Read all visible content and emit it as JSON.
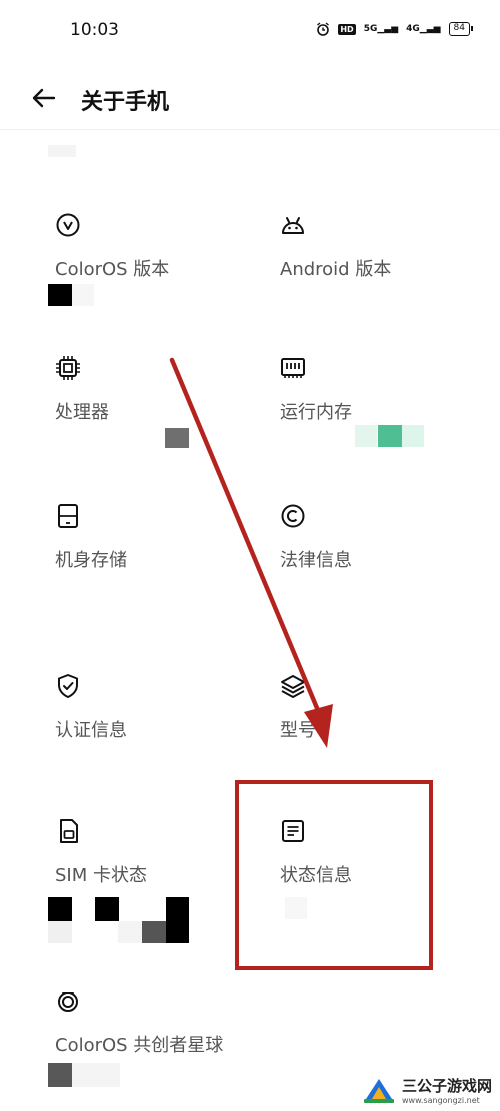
{
  "status_bar": {
    "time": "10:03",
    "hd": "HD",
    "signal1": "5G",
    "signal2": "4G",
    "battery": "84"
  },
  "header": {
    "title": "关于手机"
  },
  "tiles": [
    {
      "name": "coloros-version",
      "label": "ColorOS 版本",
      "value": "",
      "icon": "v-circle-icon"
    },
    {
      "name": "android-version",
      "label": "Android 版本",
      "value": "",
      "icon": "android-icon"
    },
    {
      "name": "processor",
      "label": "处理器",
      "value": "",
      "icon": "chip-icon"
    },
    {
      "name": "ram",
      "label": "运行内存",
      "value": "",
      "icon": "memory-icon"
    },
    {
      "name": "storage",
      "label": "机身存储",
      "value": "",
      "icon": "storage-icon"
    },
    {
      "name": "legal",
      "label": "法律信息",
      "value": "",
      "icon": "copyright-icon"
    },
    {
      "name": "certification",
      "label": "认证信息",
      "value": "",
      "icon": "shield-check-icon"
    },
    {
      "name": "model",
      "label": "型号",
      "value": "",
      "icon": "layers-icon"
    },
    {
      "name": "sim-status",
      "label": "SIM 卡状态",
      "value": "",
      "icon": "sim-card-icon"
    },
    {
      "name": "status-info",
      "label": "状态信息",
      "value": "",
      "icon": "document-icon"
    },
    {
      "name": "coloros-cocreate",
      "label": "ColorOS 共创者星球",
      "value": "",
      "icon": "planet-icon"
    }
  ],
  "colors": {
    "annotation": "#b5231f",
    "accent_green": "#4fbf93"
  },
  "watermark": {
    "title": "三公子游戏网",
    "url": "www.sangongzi.net"
  }
}
